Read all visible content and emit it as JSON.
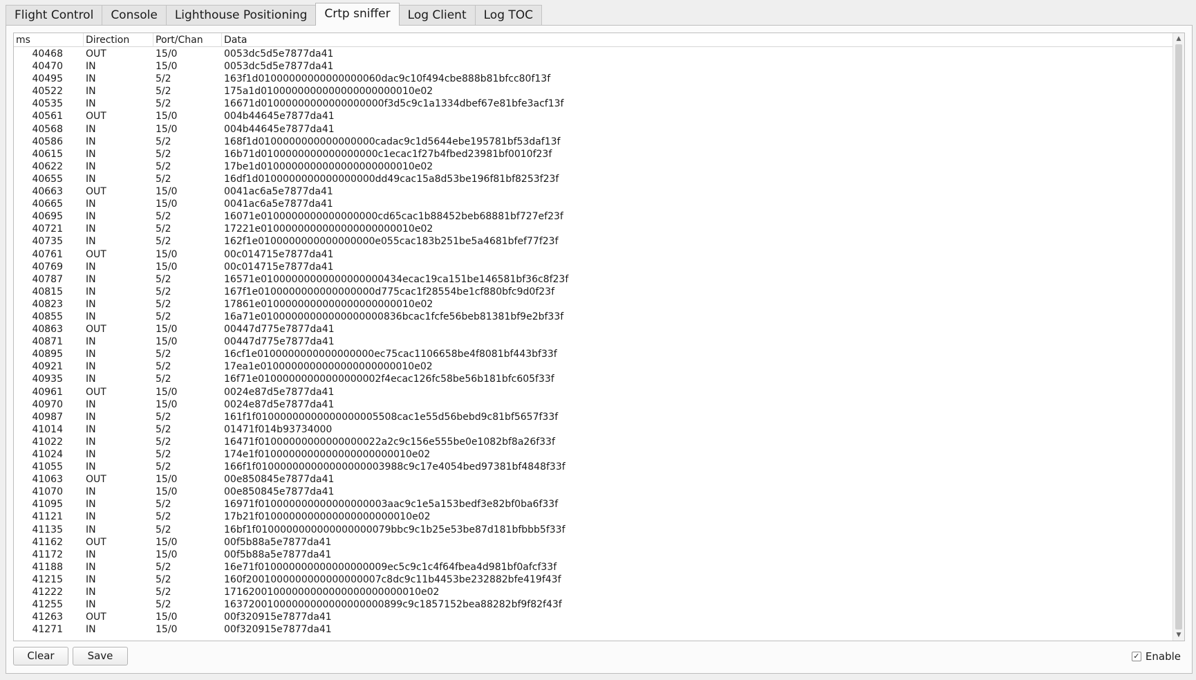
{
  "tabs": [
    {
      "label": "Flight Control",
      "active": false
    },
    {
      "label": "Console",
      "active": false
    },
    {
      "label": "Lighthouse Positioning",
      "active": false
    },
    {
      "label": "Crtp sniffer",
      "active": true
    },
    {
      "label": "Log Client",
      "active": false
    },
    {
      "label": "Log TOC",
      "active": false
    }
  ],
  "table": {
    "columns": [
      "ms",
      "Direction",
      "Port/Chan",
      "Data"
    ],
    "rows": [
      [
        "40468",
        "OUT",
        "15/0",
        "0053dc5d5e7877da41"
      ],
      [
        "40470",
        "IN",
        "15/0",
        "0053dc5d5e7877da41"
      ],
      [
        "40495",
        "IN",
        "5/2",
        "163f1d01000000000000000060dac9c10f494cbe888b81bfcc80f13f"
      ],
      [
        "40522",
        "IN",
        "5/2",
        "175a1d0100000000000000000000010e02"
      ],
      [
        "40535",
        "IN",
        "5/2",
        "16671d01000000000000000000f3d5c9c1a1334dbef67e81bfe3acf13f"
      ],
      [
        "40561",
        "OUT",
        "15/0",
        "004b44645e7877da41"
      ],
      [
        "40568",
        "IN",
        "15/0",
        "004b44645e7877da41"
      ],
      [
        "40586",
        "IN",
        "5/2",
        "168f1d0100000000000000000cadac9c1d5644ebe195781bf53daf13f"
      ],
      [
        "40615",
        "IN",
        "5/2",
        "16b71d0100000000000000000c1ecac1f27b4fbed23981bf0010f23f"
      ],
      [
        "40622",
        "IN",
        "5/2",
        "17be1d0100000000000000000000010e02"
      ],
      [
        "40655",
        "IN",
        "5/2",
        "16df1d0100000000000000000dd49cac15a8d53be196f81bf8253f23f"
      ],
      [
        "40663",
        "OUT",
        "15/0",
        "0041ac6a5e7877da41"
      ],
      [
        "40665",
        "IN",
        "15/0",
        "0041ac6a5e7877da41"
      ],
      [
        "40695",
        "IN",
        "5/2",
        "16071e0100000000000000000cd65cac1b88452beb68881bf727ef23f"
      ],
      [
        "40721",
        "IN",
        "5/2",
        "17221e0100000000000000000000010e02"
      ],
      [
        "40735",
        "IN",
        "5/2",
        "162f1e0100000000000000000e055cac183b251be5a4681bfef77f23f"
      ],
      [
        "40761",
        "OUT",
        "15/0",
        "00c014715e7877da41"
      ],
      [
        "40769",
        "IN",
        "15/0",
        "00c014715e7877da41"
      ],
      [
        "40787",
        "IN",
        "5/2",
        "16571e01000000000000000000434ecac19ca151be146581bf36c8f23f"
      ],
      [
        "40815",
        "IN",
        "5/2",
        "167f1e0100000000000000000d775cac1f28554be1cf880bfc9d0f23f"
      ],
      [
        "40823",
        "IN",
        "5/2",
        "17861e0100000000000000000000010e02"
      ],
      [
        "40855",
        "IN",
        "5/2",
        "16a71e01000000000000000000836bcac1fcfe56beb81381bf9e2bf33f"
      ],
      [
        "40863",
        "OUT",
        "15/0",
        "00447d775e7877da41"
      ],
      [
        "40871",
        "IN",
        "15/0",
        "00447d775e7877da41"
      ],
      [
        "40895",
        "IN",
        "5/2",
        "16cf1e0100000000000000000ec75cac1106658be4f8081bf443bf33f"
      ],
      [
        "40921",
        "IN",
        "5/2",
        "17ea1e0100000000000000000000010e02"
      ],
      [
        "40935",
        "IN",
        "5/2",
        "16f71e01000000000000000002f4ecac126fc58be56b181bfc605f33f"
      ],
      [
        "40961",
        "OUT",
        "15/0",
        "0024e87d5e7877da41"
      ],
      [
        "40970",
        "IN",
        "15/0",
        "0024e87d5e7877da41"
      ],
      [
        "40987",
        "IN",
        "5/2",
        "161f1f01000000000000000005508cac1e55d56bebd9c81bf5657f33f"
      ],
      [
        "41014",
        "IN",
        "5/2",
        "01471f014b93734000"
      ],
      [
        "41022",
        "IN",
        "5/2",
        "16471f01000000000000000022a2c9c156e555be0e1082bf8a26f33f"
      ],
      [
        "41024",
        "IN",
        "5/2",
        "174e1f0100000000000000000000010e02"
      ],
      [
        "41055",
        "IN",
        "5/2",
        "166f1f010000000000000000003988c9c17e4054bed97381bf4848f33f"
      ],
      [
        "41063",
        "OUT",
        "15/0",
        "00e850845e7877da41"
      ],
      [
        "41070",
        "IN",
        "15/0",
        "00e850845e7877da41"
      ],
      [
        "41095",
        "IN",
        "5/2",
        "16971f010000000000000000003aac9c1e5a153bedf3e82bf0ba6f33f"
      ],
      [
        "41121",
        "IN",
        "5/2",
        "17b21f0100000000000000000000010e02"
      ],
      [
        "41135",
        "IN",
        "5/2",
        "16bf1f0100000000000000000079bbc9c1b25e53be87d181bfbbb5f33f"
      ],
      [
        "41162",
        "OUT",
        "15/0",
        "00f5b88a5e7877da41"
      ],
      [
        "41172",
        "IN",
        "15/0",
        "00f5b88a5e7877da41"
      ],
      [
        "41188",
        "IN",
        "5/2",
        "16e71f010000000000000000009ec5c9c1c4f64fbea4d981bf0afcf33f"
      ],
      [
        "41215",
        "IN",
        "5/2",
        "160f2001000000000000000007c8dc9c11b4453be232882bfe419f43f"
      ],
      [
        "41222",
        "IN",
        "5/2",
        "17162001000000000000000000000010e02"
      ],
      [
        "41255",
        "IN",
        "5/2",
        "16372001000000000000000000899c9c1857152bea88282bf9f82f43f"
      ],
      [
        "41263",
        "OUT",
        "15/0",
        "00f320915e7877da41"
      ],
      [
        "41271",
        "IN",
        "15/0",
        "00f320915e7877da41"
      ]
    ]
  },
  "buttons": {
    "clear": "Clear",
    "save": "Save"
  },
  "enable": {
    "label": "Enable",
    "checked": true,
    "check_glyph": "✓"
  },
  "scrollbar": {
    "up_glyph": "▲",
    "down_glyph": "▼"
  }
}
